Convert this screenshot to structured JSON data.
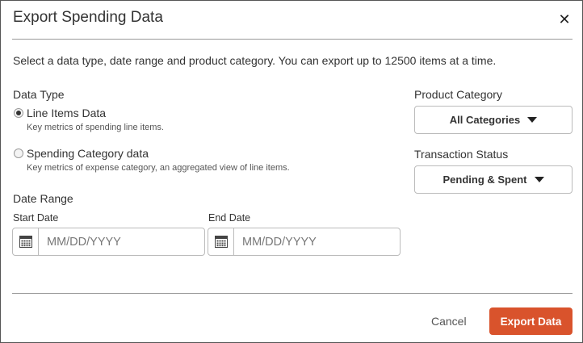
{
  "dialog": {
    "title": "Export Spending Data",
    "close_icon": "close-icon",
    "description": "Select a data type, date range and product category. You can export up to 12500 items at a time."
  },
  "data_type": {
    "heading": "Data Type",
    "options": [
      {
        "label": "Line Items Data",
        "sublabel": "Key metrics of spending line items.",
        "selected": true
      },
      {
        "label": "Spending Category data",
        "sublabel": "Key metrics of expense category, an aggregated view of line items.",
        "selected": false
      }
    ]
  },
  "date_range": {
    "heading": "Date Range",
    "start": {
      "label": "Start Date",
      "placeholder": "MM/DD/YYYY",
      "value": "",
      "icon": "calendar-icon"
    },
    "end": {
      "label": "End Date",
      "placeholder": "MM/DD/YYYY",
      "value": "",
      "icon": "calendar-icon"
    }
  },
  "product_category": {
    "heading": "Product Category",
    "selected": "All Categories"
  },
  "transaction_status": {
    "heading": "Transaction Status",
    "selected": "Pending & Spent"
  },
  "footer": {
    "cancel_label": "Cancel",
    "export_label": "Export Data",
    "export_color": "#d9532c"
  }
}
